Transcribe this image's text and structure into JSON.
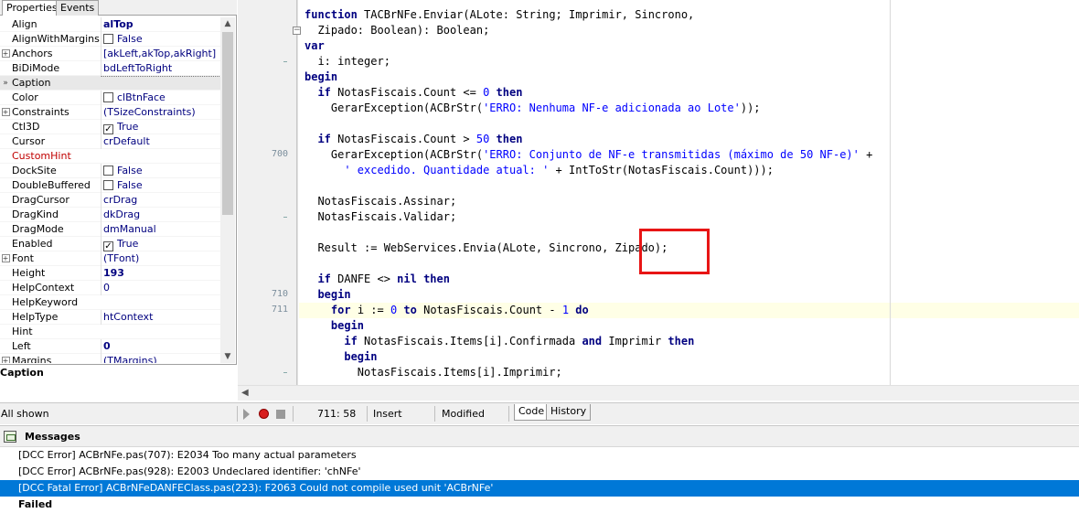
{
  "inspector": {
    "tabs": [
      "Properties",
      "Events"
    ],
    "properties": [
      {
        "name": "Align",
        "value": "alTop",
        "bold": true
      },
      {
        "name": "AlignWithMargins",
        "value": "False",
        "checkbox": "unchecked"
      },
      {
        "name": "Anchors",
        "value": "[akLeft,akTop,akRight]",
        "expand": true
      },
      {
        "name": "BiDiMode",
        "value": "bdLeftToRight"
      },
      {
        "name": "Caption",
        "value": "",
        "selected": true
      },
      {
        "name": "Color",
        "value": "clBtnFace",
        "checkbox": "unchecked"
      },
      {
        "name": "Constraints",
        "value": "(TSizeConstraints)",
        "expand": true
      },
      {
        "name": "Ctl3D",
        "value": "True",
        "checkbox": "checked"
      },
      {
        "name": "Cursor",
        "value": "crDefault"
      },
      {
        "name": "CustomHint",
        "value": "",
        "red": true
      },
      {
        "name": "DockSite",
        "value": "False",
        "checkbox": "unchecked"
      },
      {
        "name": "DoubleBuffered",
        "value": "False",
        "checkbox": "unchecked"
      },
      {
        "name": "DragCursor",
        "value": "crDrag"
      },
      {
        "name": "DragKind",
        "value": "dkDrag"
      },
      {
        "name": "DragMode",
        "value": "dmManual"
      },
      {
        "name": "Enabled",
        "value": "True",
        "checkbox": "checked"
      },
      {
        "name": "Font",
        "value": "(TFont)",
        "expand": true
      },
      {
        "name": "Height",
        "value": "193",
        "bold": true
      },
      {
        "name": "HelpContext",
        "value": "0"
      },
      {
        "name": "HelpKeyword",
        "value": ""
      },
      {
        "name": "HelpType",
        "value": "htContext"
      },
      {
        "name": "Hint",
        "value": ""
      },
      {
        "name": "Left",
        "value": "0",
        "bold": true
      },
      {
        "name": "Margins",
        "value": "(TMargins)",
        "expand": true
      }
    ],
    "description_title": "Caption",
    "status_text": "All shown",
    "selected_marker": "»",
    "icons": {
      "expand": "plus-box-icon",
      "check": "checkbox-icon"
    }
  },
  "editor": {
    "lines": [
      [
        {
          "t": "function ",
          "c": "kw"
        },
        {
          "t": "TACBrNFe.Enviar(ALote: String; Imprimir, Sincrono,"
        }
      ],
      [
        {
          "t": "  Zipado: Boolean): Boolean;"
        }
      ],
      [
        {
          "t": "var",
          "c": "kw"
        }
      ],
      [
        {
          "t": "  i: integer;"
        }
      ],
      [
        {
          "t": "begin",
          "c": "kw"
        }
      ],
      [
        {
          "t": "  "
        },
        {
          "t": "if",
          "c": "kw"
        },
        {
          "t": " NotasFiscais.Count <= "
        },
        {
          "t": "0",
          "c": "num"
        },
        {
          "t": " "
        },
        {
          "t": "then",
          "c": "kw"
        }
      ],
      [
        {
          "t": "    GerarException(ACBrStr("
        },
        {
          "t": "'ERRO: Nenhuma NF-e adicionada ao Lote'",
          "c": "str"
        },
        {
          "t": "));"
        }
      ],
      [
        {
          "t": ""
        }
      ],
      [
        {
          "t": "  "
        },
        {
          "t": "if",
          "c": "kw"
        },
        {
          "t": " NotasFiscais.Count > "
        },
        {
          "t": "50",
          "c": "num"
        },
        {
          "t": " "
        },
        {
          "t": "then",
          "c": "kw"
        }
      ],
      [
        {
          "t": "    GerarException(ACBrStr("
        },
        {
          "t": "'ERRO: Conjunto de NF-e transmitidas (máximo de 50 NF-e)'",
          "c": "str"
        },
        {
          "t": " +"
        }
      ],
      [
        {
          "t": "      "
        },
        {
          "t": "' excedido. Quantidade atual: '",
          "c": "str"
        },
        {
          "t": " + IntToStr(NotasFiscais.Count)));"
        }
      ],
      [
        {
          "t": ""
        }
      ],
      [
        {
          "t": "  NotasFiscais.Assinar;"
        }
      ],
      [
        {
          "t": "  NotasFiscais.Validar;"
        }
      ],
      [
        {
          "t": ""
        }
      ],
      [
        {
          "t": "  Result := WebServices.Envia(ALote, Sincrono, Zipado);"
        }
      ],
      [
        {
          "t": ""
        }
      ],
      [
        {
          "t": "  "
        },
        {
          "t": "if",
          "c": "kw"
        },
        {
          "t": " DANFE <> "
        },
        {
          "t": "nil",
          "c": "kw"
        },
        {
          "t": " "
        },
        {
          "t": "then",
          "c": "kw"
        }
      ],
      [
        {
          "t": "  "
        },
        {
          "t": "begin",
          "c": "kw"
        }
      ],
      [
        {
          "t": "    "
        },
        {
          "t": "for",
          "c": "kw"
        },
        {
          "t": " i := "
        },
        {
          "t": "0",
          "c": "num"
        },
        {
          "t": " "
        },
        {
          "t": "to",
          "c": "kw"
        },
        {
          "t": " NotasFiscais.Count - "
        },
        {
          "t": "1",
          "c": "num"
        },
        {
          "t": " "
        },
        {
          "t": "do",
          "c": "kw"
        }
      ],
      [
        {
          "t": "    "
        },
        {
          "t": "begin",
          "c": "kw"
        }
      ],
      [
        {
          "t": "      "
        },
        {
          "t": "if",
          "c": "kw"
        },
        {
          "t": " NotasFiscais.Items[i].Confirmada "
        },
        {
          "t": "and",
          "c": "kw"
        },
        {
          "t": " Imprimir "
        },
        {
          "t": "then",
          "c": "kw"
        }
      ],
      [
        {
          "t": "      "
        },
        {
          "t": "begin",
          "c": "kw"
        }
      ],
      [
        {
          "t": "        NotasFiscais.Items[i].Imprimir;"
        }
      ]
    ],
    "gutter_numbers": [
      {
        "line": 9,
        "label": "700"
      },
      {
        "line": 18,
        "label": "710"
      },
      {
        "line": 19,
        "label": "711"
      }
    ],
    "current_line_index": 19,
    "highlight_word": "Zipado);"
  },
  "status": {
    "position": "711: 58",
    "mode": "Insert",
    "state": "Modified",
    "tabs": [
      "Code",
      "History"
    ],
    "active_tab": "Code"
  },
  "messages": {
    "title": "Messages",
    "items": [
      {
        "text": "[DCC Error] ACBrNFe.pas(707): E2034 Too many actual parameters"
      },
      {
        "text": "[DCC Error] ACBrNFe.pas(928): E2003 Undeclared identifier: 'chNFe'"
      },
      {
        "text": "[DCC Fatal Error] ACBrNFeDANFEClass.pas(223): F2063 Could not compile used unit 'ACBrNFe'",
        "selected": true
      },
      {
        "text": "Failed",
        "bold": true
      }
    ]
  }
}
